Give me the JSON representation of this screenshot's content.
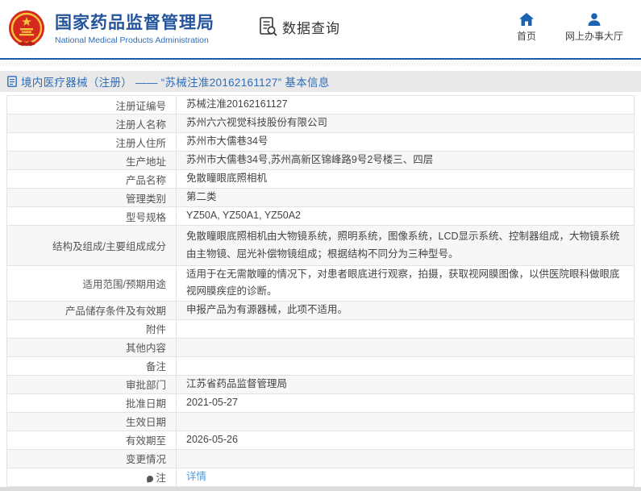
{
  "header": {
    "org_name_cn": "国家药品监督管理局",
    "org_name_en": "National Medical Products Administration",
    "section_title": "数据查询",
    "nav": {
      "home_label": "首页",
      "service_hall_label": "网上办事大厅"
    }
  },
  "page": {
    "title": "境内医疗器械（注册） —— “苏械注准20162161127” 基本信息"
  },
  "table": {
    "rows": [
      {
        "label": "注册证编号",
        "value": "苏械注准20162161127"
      },
      {
        "label": "注册人名称",
        "value": "苏州六六视觉科技股份有限公司"
      },
      {
        "label": "注册人住所",
        "value": "苏州市大儒巷34号"
      },
      {
        "label": "生产地址",
        "value": "苏州市大儒巷34号,苏州高新区锦峰路9号2号楼三、四层"
      },
      {
        "label": "产品名称",
        "value": "免散瞳眼底照相机"
      },
      {
        "label": "管理类别",
        "value": "第二类"
      },
      {
        "label": "型号规格",
        "value": "YZ50A, YZ50A1, YZ50A2"
      },
      {
        "label": "结构及组成/主要组成成分",
        "value": "免散瞳眼底照相机由大物镜系统，照明系统，图像系统，LCD显示系统、控制器组成，大物镜系统由主物镜、屈光补偿物镜组成；根据结构不同分为三种型号。",
        "tall": true
      },
      {
        "label": "适用范围/预期用途",
        "value": "适用于在无需散瞳的情况下，对患者眼底进行观察，拍摄，获取视网膜图像，以供医院眼科做眼底视网膜疾症的诊断。"
      },
      {
        "label": "产品储存条件及有效期",
        "value": "申报产品为有源器械，此项不适用。"
      },
      {
        "label": "附件",
        "value": ""
      },
      {
        "label": "其他内容",
        "value": ""
      },
      {
        "label": "备注",
        "value": ""
      },
      {
        "label": "审批部门",
        "value": "江苏省药品监督管理局"
      },
      {
        "label": "批准日期",
        "value": "2021-05-27"
      },
      {
        "label": "生效日期",
        "value": ""
      },
      {
        "label": "有效期至",
        "value": "2026-05-26"
      },
      {
        "label": "变更情况",
        "value": ""
      },
      {
        "label": "注",
        "value": "详情",
        "link": true,
        "label_icon": "note-bubble"
      }
    ]
  },
  "colors": {
    "brand_blue": "#24549c",
    "rule_blue": "#1b5cab",
    "link_blue": "#4b9ce0",
    "title_bar_bg": "#e9e9e9",
    "stripe_bg": "#f7f7f7",
    "emblem_red": "#d5281e",
    "emblem_gold": "#f5c33c"
  }
}
